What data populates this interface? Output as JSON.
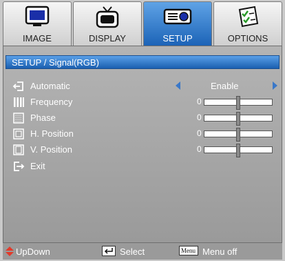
{
  "tabs": [
    {
      "label": "IMAGE",
      "icon": "monitor-icon",
      "active": false
    },
    {
      "label": "DISPLAY",
      "icon": "tv-icon",
      "active": false
    },
    {
      "label": "SETUP",
      "icon": "projector-icon",
      "active": true
    },
    {
      "label": "OPTIONS",
      "icon": "checklist-icon",
      "active": false
    }
  ],
  "title": "SETUP / Signal(RGB)",
  "rows": [
    {
      "label": "Automatic",
      "icon": "automatic-icon",
      "value": "Enable"
    },
    {
      "label": "Frequency",
      "icon": "frequency-icon",
      "value": "0",
      "level": 0.5
    },
    {
      "label": "Phase",
      "icon": "phase-icon",
      "value": "0",
      "level": 0.5
    },
    {
      "label": "H. Position",
      "icon": "h-position-icon",
      "value": "0",
      "level": 0.5
    },
    {
      "label": "V. Position",
      "icon": "v-position-icon",
      "value": "0",
      "level": 0.5
    },
    {
      "label": "Exit",
      "icon": "exit-icon"
    }
  ],
  "footer": {
    "updown": "UpDown",
    "select": "Select",
    "menu_key": "Menu",
    "menu_off": "Menu off"
  },
  "colors": {
    "accent": "#1c63b7",
    "panel": "#a8a8a8"
  }
}
